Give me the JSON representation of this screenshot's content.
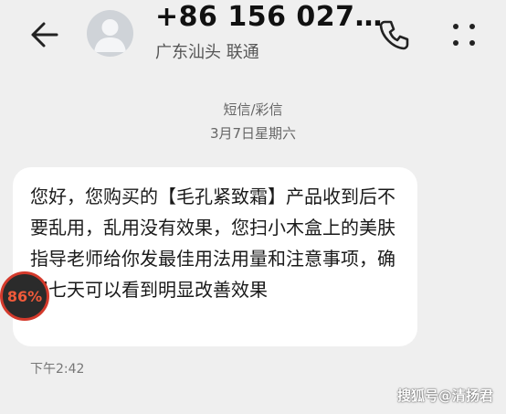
{
  "header": {
    "contact_number": "+86 156 027…",
    "contact_location": "广东汕头 联通",
    "back_icon": "arrow-left-icon",
    "call_icon": "phone-icon",
    "more_icon": "more-vertical-icon"
  },
  "conversation": {
    "message_type": "短信/彩信",
    "date": "3月7日星期六",
    "messages": [
      {
        "text": "您好，您购买的【毛孔紧致霜】产品收到后不要乱用，乱用没有效果，您扫小木盒上的美肤指导老师给你发最佳用法用量和注意事项，确保七天可以看到明显改善效果",
        "time": "下午2:42"
      }
    ]
  },
  "overlay": {
    "badge_text": "86%"
  },
  "watermark": {
    "text": "搜狐号@清扬君"
  },
  "colors": {
    "background": "#efefef",
    "bubble": "#ffffff",
    "badge_ring": "#d43a2c",
    "badge_text": "#f05a3a"
  }
}
